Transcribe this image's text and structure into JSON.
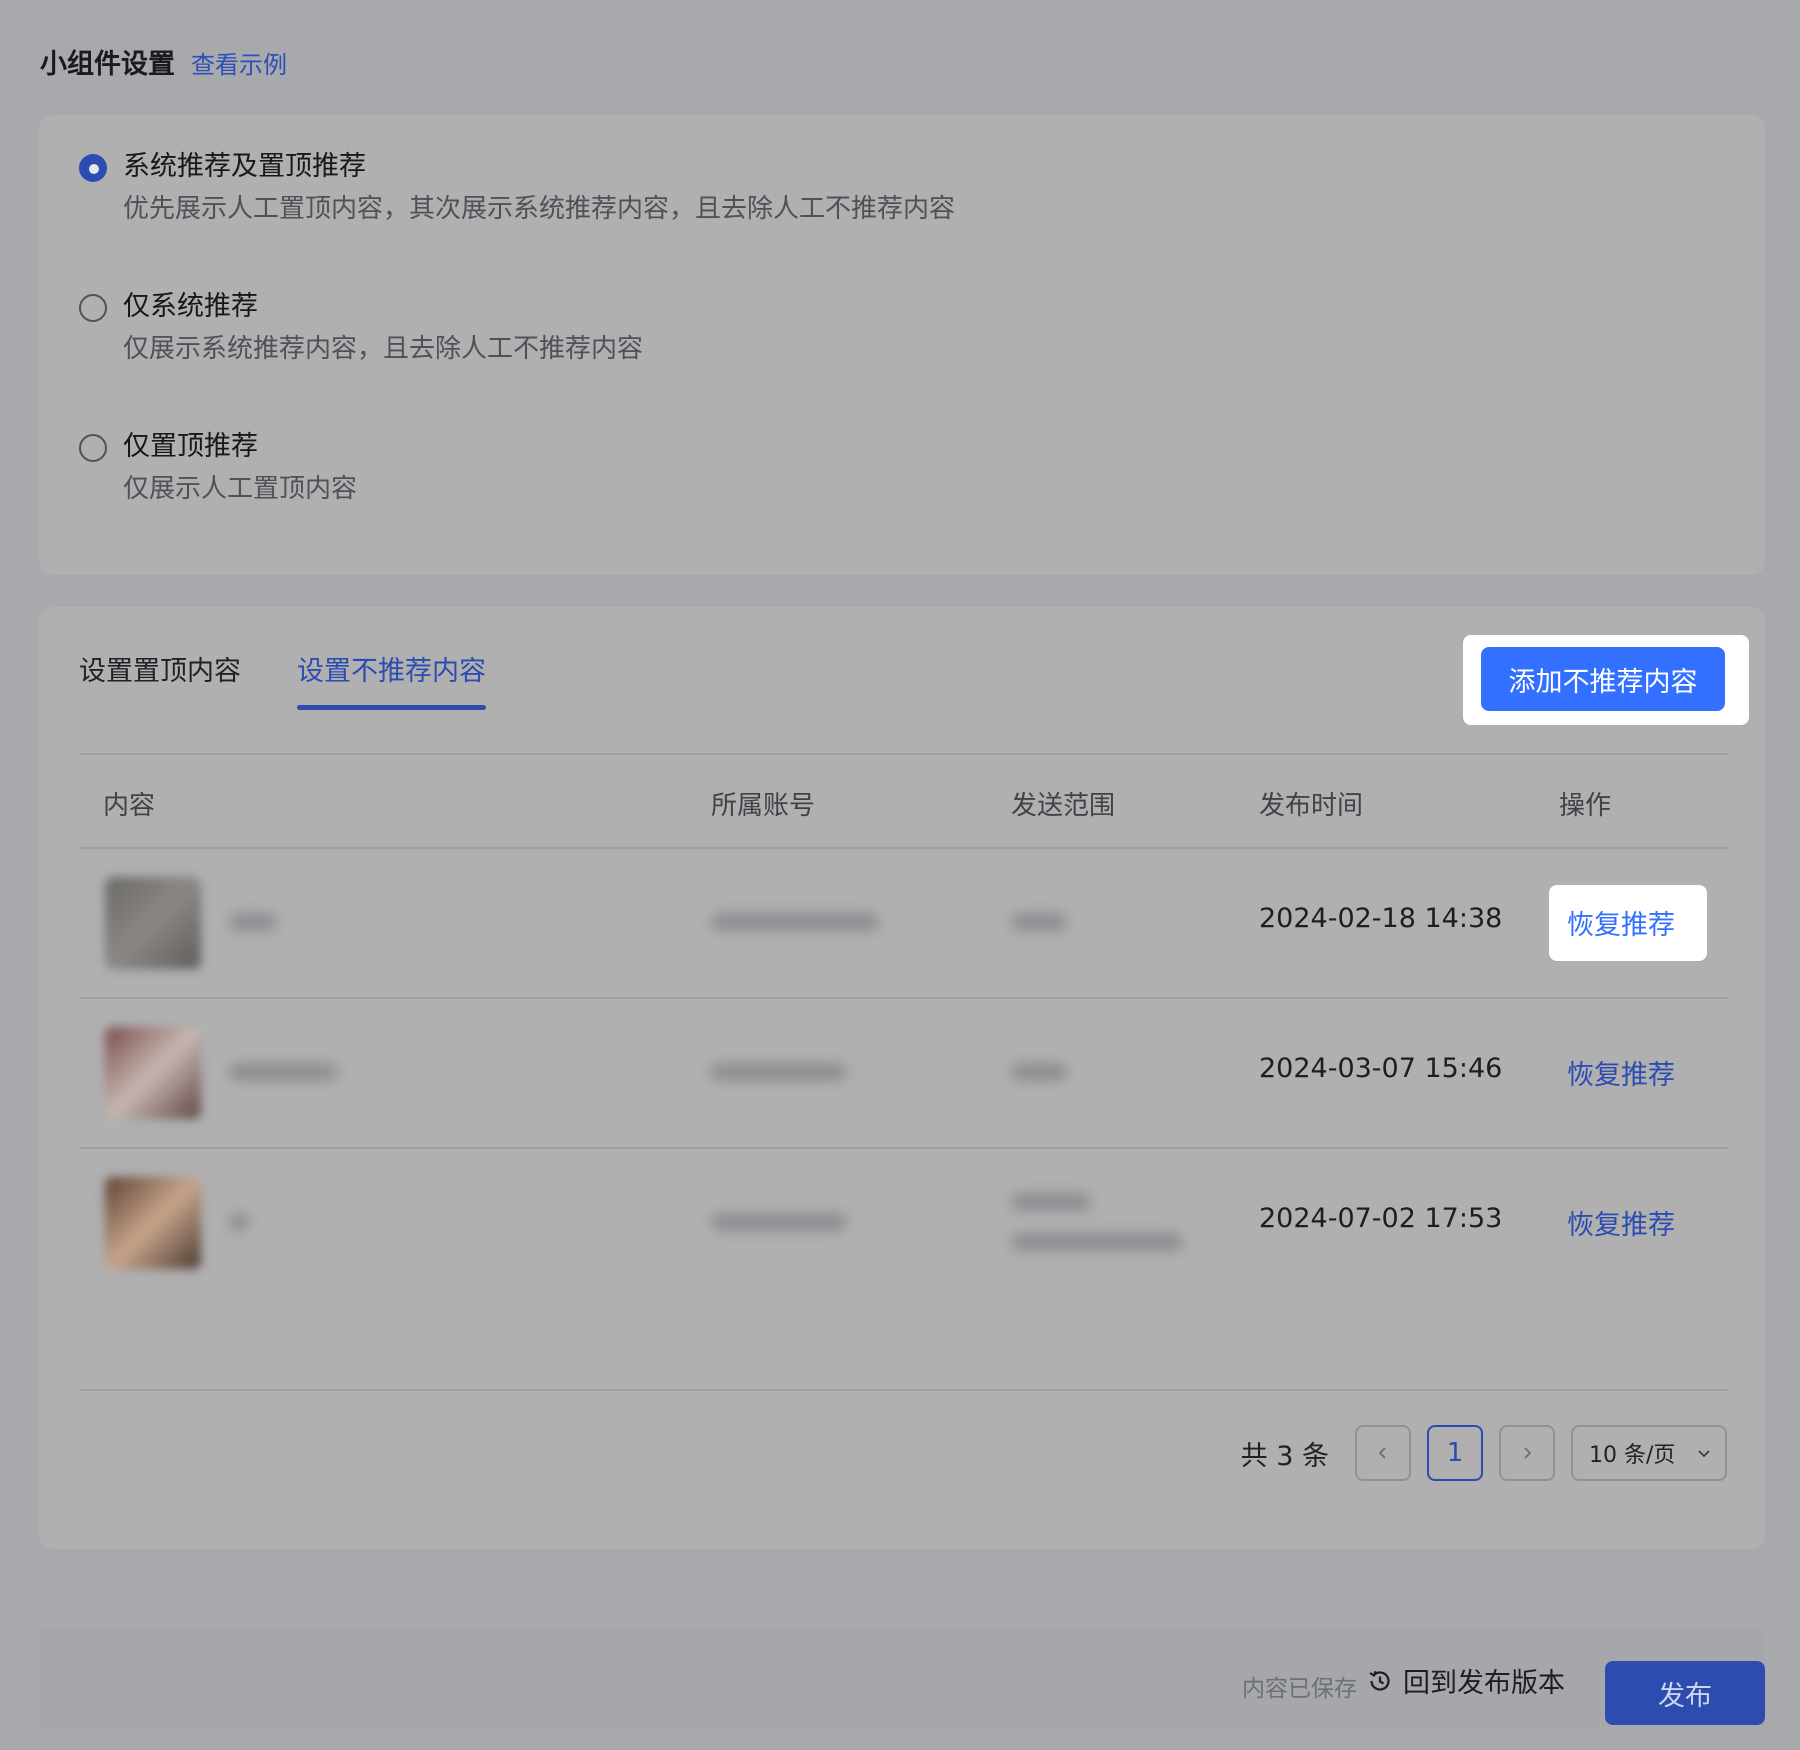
{
  "header": {
    "title": "小组件设置",
    "example_link": "查看示例"
  },
  "options": [
    {
      "title": "系统推荐及置顶推荐",
      "desc": "优先展示人工置顶内容，其次展示系统推荐内容，且去除人工不推荐内容",
      "selected": true
    },
    {
      "title": "仅系统推荐",
      "desc": "仅展示系统推荐内容，且去除人工不推荐内容",
      "selected": false
    },
    {
      "title": "仅置顶推荐",
      "desc": "仅展示人工置顶内容",
      "selected": false
    }
  ],
  "tabs": [
    {
      "label": "设置置顶内容",
      "active": false
    },
    {
      "label": "设置不推荐内容",
      "active": true
    }
  ],
  "add_button": "添加不推荐内容",
  "table": {
    "columns": [
      "内容",
      "所属账号",
      "发送范围",
      "发布时间",
      "操作"
    ],
    "rows": [
      {
        "time": "2024-02-18 14:38",
        "action": "恢复推荐"
      },
      {
        "time": "2024-03-07 15:46",
        "action": "恢复推荐"
      },
      {
        "time": "2024-07-02 17:53",
        "action": "恢复推荐"
      }
    ]
  },
  "pagination": {
    "total": "共 3 条",
    "current_page": "1",
    "page_size": "10 条/页"
  },
  "footer": {
    "saved_status": "内容已保存",
    "revert_label": "回到发布版本",
    "publish_label": "发布"
  },
  "colors": {
    "accent": "#2c4cb0",
    "primary_button": "#3370ff",
    "overlay_bg": "#a6a7aa"
  },
  "icons": [
    "radio-selected-icon",
    "radio-unselected-icon",
    "chevron-left-icon",
    "chevron-right-icon",
    "chevron-down-icon",
    "history-icon"
  ]
}
